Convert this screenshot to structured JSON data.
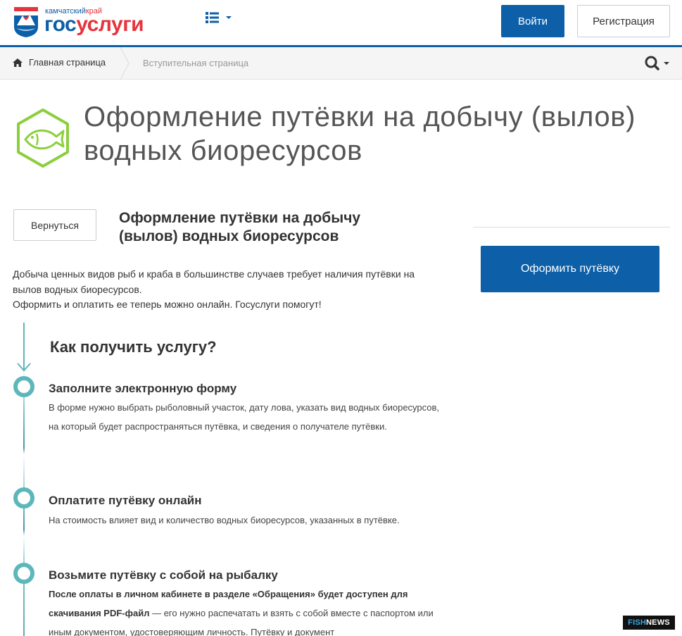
{
  "header": {
    "logo_region_prefix": "камчатский",
    "logo_region_suffix": "край",
    "logo_name_part1": "гос",
    "logo_name_part2": "услуги",
    "login_label": "Войти",
    "register_label": "Регистрация"
  },
  "breadcrumb": {
    "home_label": "Главная страница",
    "current_label": "Вступительная страница"
  },
  "service": {
    "title": "Оформление путёвки на добычу (вылов) водных биоресурсов",
    "subtitle": "Оформление путёвки на добычу (вылов) водных биоресурсов",
    "back_label": "Вернуться",
    "apply_label": "Оформить путёвку",
    "intro_line1": "Добыча ценных видов рыб и краба в большинстве случаев требует наличия путёвки на вылов водных биоресурсов.",
    "intro_line2": "Оформить и оплатить ее теперь можно онлайн. Госуслуги помогут!"
  },
  "how": {
    "title": "Как получить услугу?",
    "steps": [
      {
        "title": "Заполните электронную форму",
        "text": "В форме нужно выбрать рыболовный участок, дату лова, указать вид водных биоресурсов, на который будет распространяться путёвка, и сведения о получателе путёвки."
      },
      {
        "title": "Оплатите путёвку онлайн",
        "text": "На стоимость влияет вид и количество водных биоресурсов, указанных в путёвке."
      },
      {
        "title": "Возьмите путёвку с собой на рыбалку",
        "text_bold": "После оплаты в личном кабинете в разделе «Обращения» будет доступен для скачивания PDF-файл",
        "text": " — его нужно распечатать и взять с собой вместе с паспортом или иным документом, удостоверяющим личность. Путёвку и документ"
      }
    ]
  },
  "watermark": {
    "part1": "FISH",
    "part2": "NEWS"
  },
  "colors": {
    "brand_blue": "#0d5fa8",
    "brand_red": "#e6333c",
    "step_teal": "#5db6ba",
    "icon_green": "#8ccf3c"
  }
}
